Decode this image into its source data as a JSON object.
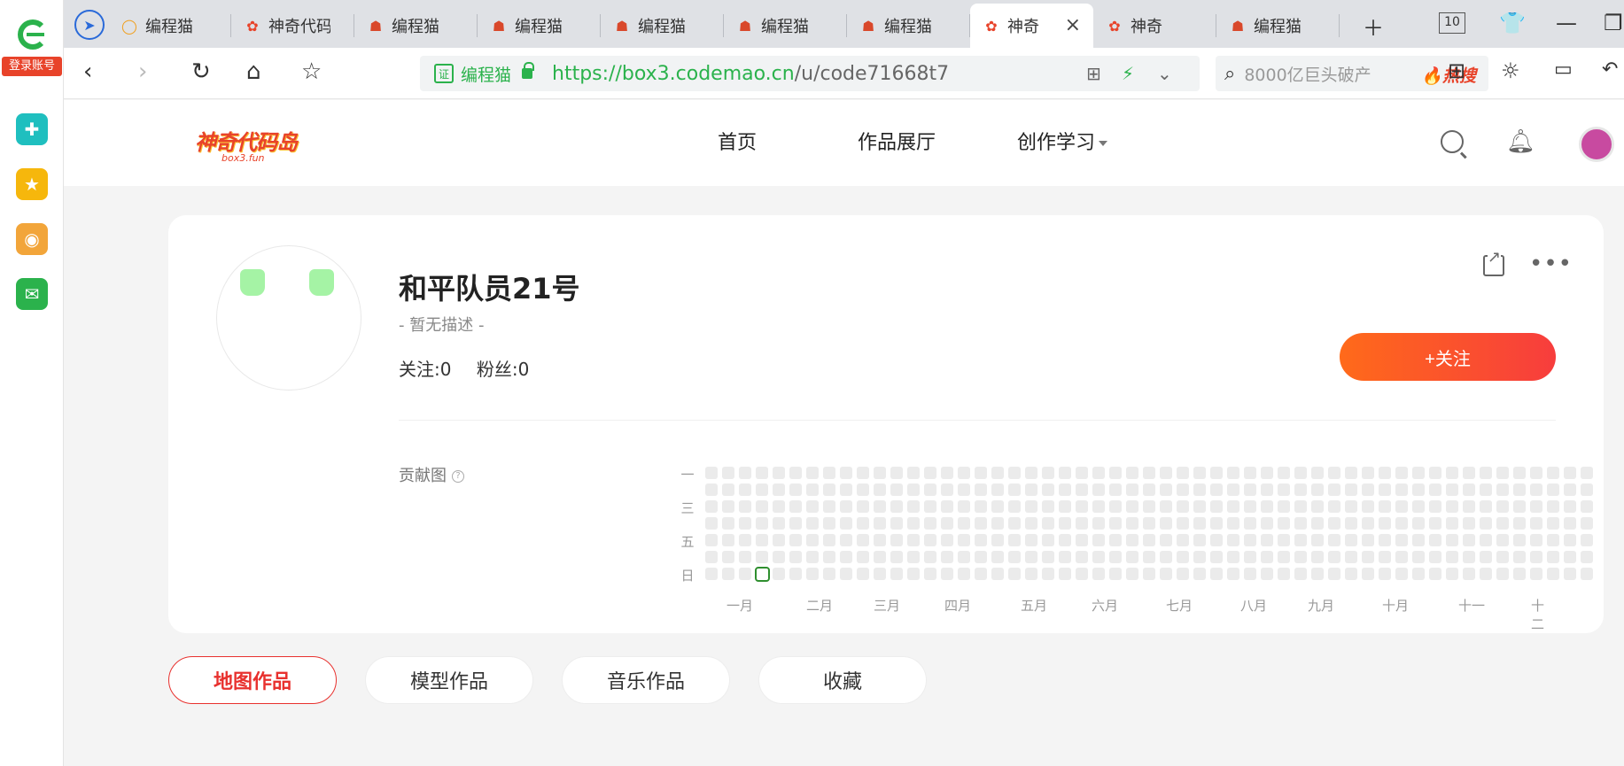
{
  "sidebar": {
    "login_label": "登录账号",
    "apps": [
      {
        "icon": "cross-app-icon",
        "color": "#1fbfbf",
        "glyph": "✚"
      },
      {
        "icon": "star-favorites-icon",
        "color": "#f6b70c",
        "glyph": "★"
      },
      {
        "icon": "weibo-icon",
        "color": "#f2a53a",
        "glyph": "◉"
      },
      {
        "icon": "mail-icon",
        "color": "#2bb24c",
        "glyph": "✉"
      }
    ]
  },
  "tabs": [
    {
      "title": "编程猫",
      "icon": "search-q-icon"
    },
    {
      "title": "神奇代码岛",
      "icon": "shenqi-icon"
    },
    {
      "title": "编程猫",
      "icon": "codemao-icon"
    },
    {
      "title": "编程猫",
      "icon": "codemao-icon"
    },
    {
      "title": "编程猫",
      "icon": "codemao-icon"
    },
    {
      "title": "编程猫",
      "icon": "codemao-icon"
    },
    {
      "title": "编程猫",
      "icon": "codemao-icon"
    },
    {
      "title": "神奇",
      "icon": "shenqi-icon",
      "active": true
    },
    {
      "title": "神奇",
      "icon": "shenqi-icon"
    },
    {
      "title": "编程猫",
      "icon": "codemao-icon"
    }
  ],
  "tabbar": {
    "tab_count": "10"
  },
  "addressbar": {
    "cert_label": "证",
    "site_name": "编程猫",
    "url_scheme": "https://",
    "url_host": "box3.codemao.cn",
    "url_path": "/u/code71668t7",
    "search_placeholder": "8000亿巨头破产",
    "hot_label": "🔥热搜"
  },
  "site": {
    "logo_text": "神奇代码岛",
    "logo_sub": "box3.fun",
    "nav": [
      "首页",
      "作品展厅",
      "创作学习"
    ]
  },
  "profile": {
    "name": "和平队员21号",
    "description": "- 暂无描述 -",
    "following": "关注:0",
    "followers": "粉丝:0",
    "follow_button": "+关注",
    "contrib_label": "贡献图",
    "help_glyph": "?",
    "weekday_labels": [
      "一",
      "三",
      "五",
      "日"
    ],
    "months": [
      "一月",
      "二月",
      "三月",
      "四月",
      "五月",
      "六月",
      "七月",
      "八月",
      "九月",
      "十月",
      "十一",
      "十二"
    ]
  },
  "profile_tabs": [
    "地图作品",
    "模型作品",
    "音乐作品",
    "收藏"
  ],
  "colors": {
    "accent": "#e8312e",
    "follow_gradient_start": "#ff6a1a",
    "follow_gradient_end": "#f73d3d",
    "url_green": "#2bb24c",
    "contribution_highlight": "#2f8f2f"
  }
}
